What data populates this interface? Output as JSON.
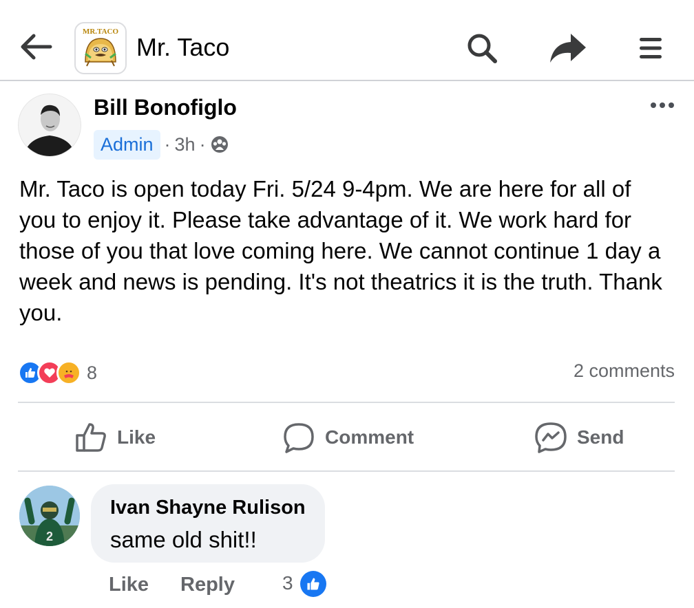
{
  "header": {
    "page_name": "Mr. Taco",
    "logo_text": "MR.TACO",
    "icons": [
      "back-arrow-icon",
      "search-icon",
      "share-arrow-icon",
      "hamburger-menu-icon"
    ]
  },
  "post": {
    "author": "Bill Bonofiglo",
    "badge": "Admin",
    "sep1": "·",
    "time": "3h",
    "sep2": "·",
    "privacy_icon": "group-icon",
    "body": "Mr. Taco is open today Fri. 5/24 9-4pm. We are here for all of you to enjoy it. Please take advantage of it. We work hard for those of you that love coming here. We cannot continue 1 day a week and news is pending. It's not theatrics it is the truth. Thank you.",
    "reactions": {
      "types": [
        "like",
        "love",
        "care"
      ],
      "count": "8"
    },
    "comments_count": "2 comments",
    "actions": {
      "like": "Like",
      "comment": "Comment",
      "send": "Send"
    }
  },
  "comment": {
    "author": "Ivan Shayne Rulison",
    "text": "same old shit!!",
    "like_label": "Like",
    "reply_label": "Reply",
    "reaction_count": "3"
  },
  "colors": {
    "facebook_blue": "#1877f2",
    "love_red": "#f33e58",
    "care_yellow": "#f7b125",
    "secondary_text": "#65676b"
  }
}
